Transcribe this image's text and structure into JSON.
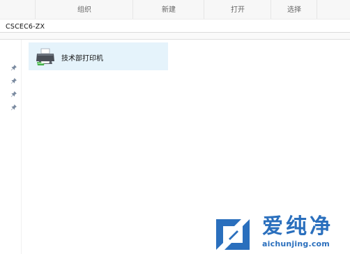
{
  "ribbon": {
    "groups": [
      "",
      "组织",
      "新建",
      "打开",
      "选择",
      ""
    ]
  },
  "address": {
    "path": "CSCEC6-ZX"
  },
  "nav": {
    "pin_icon": "pin-icon",
    "pins": 4
  },
  "content": {
    "items": [
      {
        "label": "技术部打印机",
        "icon": "printer-icon",
        "selected": true
      }
    ]
  },
  "watermark": {
    "brand": "爱纯净",
    "url": "aichunjing.com",
    "color": "#2a6fbd"
  },
  "colors": {
    "selection": "#e5f3fb",
    "ribbon_bg": "#f7f7f7",
    "accent": "#2a6fbd"
  }
}
